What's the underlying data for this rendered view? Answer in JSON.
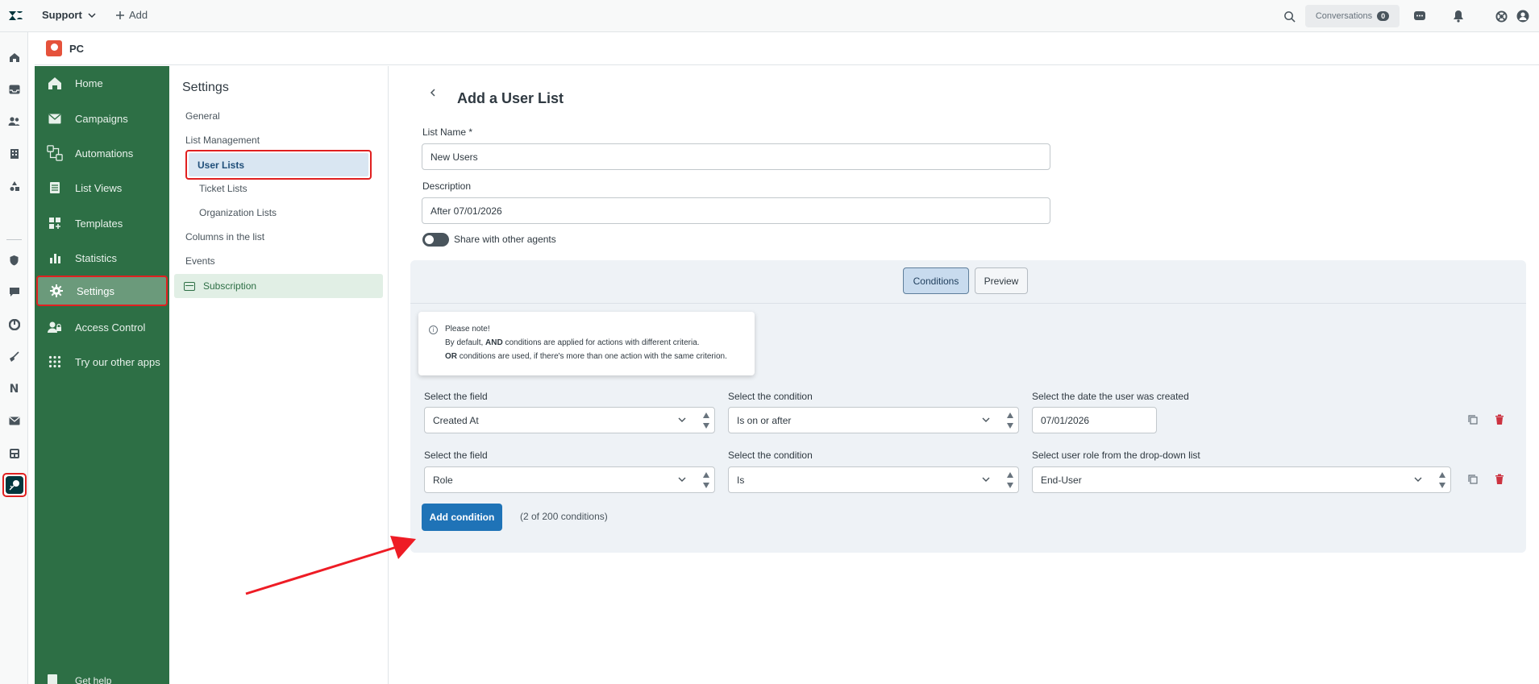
{
  "topbar": {
    "workspace": "Support",
    "add_label": "Add",
    "conversations_label": "Conversations",
    "conversations_count": "0"
  },
  "app": {
    "name": "PC"
  },
  "app_nav": {
    "items": [
      {
        "label": "Home",
        "icon": "home-icon"
      },
      {
        "label": "Campaigns",
        "icon": "mail-icon"
      },
      {
        "label": "Automations",
        "icon": "automations-icon"
      },
      {
        "label": "List Views",
        "icon": "list-views-icon"
      },
      {
        "label": "Templates",
        "icon": "templates-icon"
      },
      {
        "label": "Statistics",
        "icon": "bar-chart-icon"
      },
      {
        "label": "Settings",
        "icon": "gear-icon"
      },
      {
        "label": "Access Control",
        "icon": "user-lock-icon"
      },
      {
        "label": "Try our other apps",
        "icon": "grid-dots-icon"
      }
    ],
    "active": "Settings",
    "get_help": "Get help"
  },
  "settings_nav": {
    "title": "Settings",
    "general": "General",
    "list_management": "List Management",
    "user_lists": "User Lists",
    "ticket_lists": "Ticket Lists",
    "organization_lists": "Organization Lists",
    "columns": "Columns in the list",
    "events": "Events",
    "subscription": "Subscription"
  },
  "main": {
    "title": "Add a User List",
    "list_name_label": "List Name *",
    "list_name_value": "New Users",
    "description_label": "Description",
    "description_value": "After 07/01/2026",
    "share_label": "Share with other agents",
    "tabs": {
      "conditions": "Conditions",
      "preview": "Preview"
    },
    "note": {
      "title": "Please note!",
      "line1_prefix": "By default, ",
      "line1_bold": "AND",
      "line1_suffix": " conditions are applied for actions with different criteria.",
      "line2_bold": "OR",
      "line2_suffix": " conditions are used, if there's more than one action with the same criterion."
    },
    "conditions": [
      {
        "field_label": "Select the field",
        "field_value": "Created At",
        "condition_label": "Select the condition",
        "condition_value": "Is on or after",
        "value_label": "Select the date the user was created",
        "value": "07/01/2026"
      },
      {
        "field_label": "Select the field",
        "field_value": "Role",
        "condition_label": "Select the condition",
        "condition_value": "Is",
        "value_label": "Select user role from the drop-down list",
        "value": "End-User"
      }
    ],
    "add_condition": "Add condition",
    "condition_count": "(2 of 200 conditions)"
  },
  "colors": {
    "nav_green": "#2d6f45",
    "primary_blue": "#1f73b7",
    "highlight_red": "#e02020",
    "delete_red": "#cc3340"
  }
}
